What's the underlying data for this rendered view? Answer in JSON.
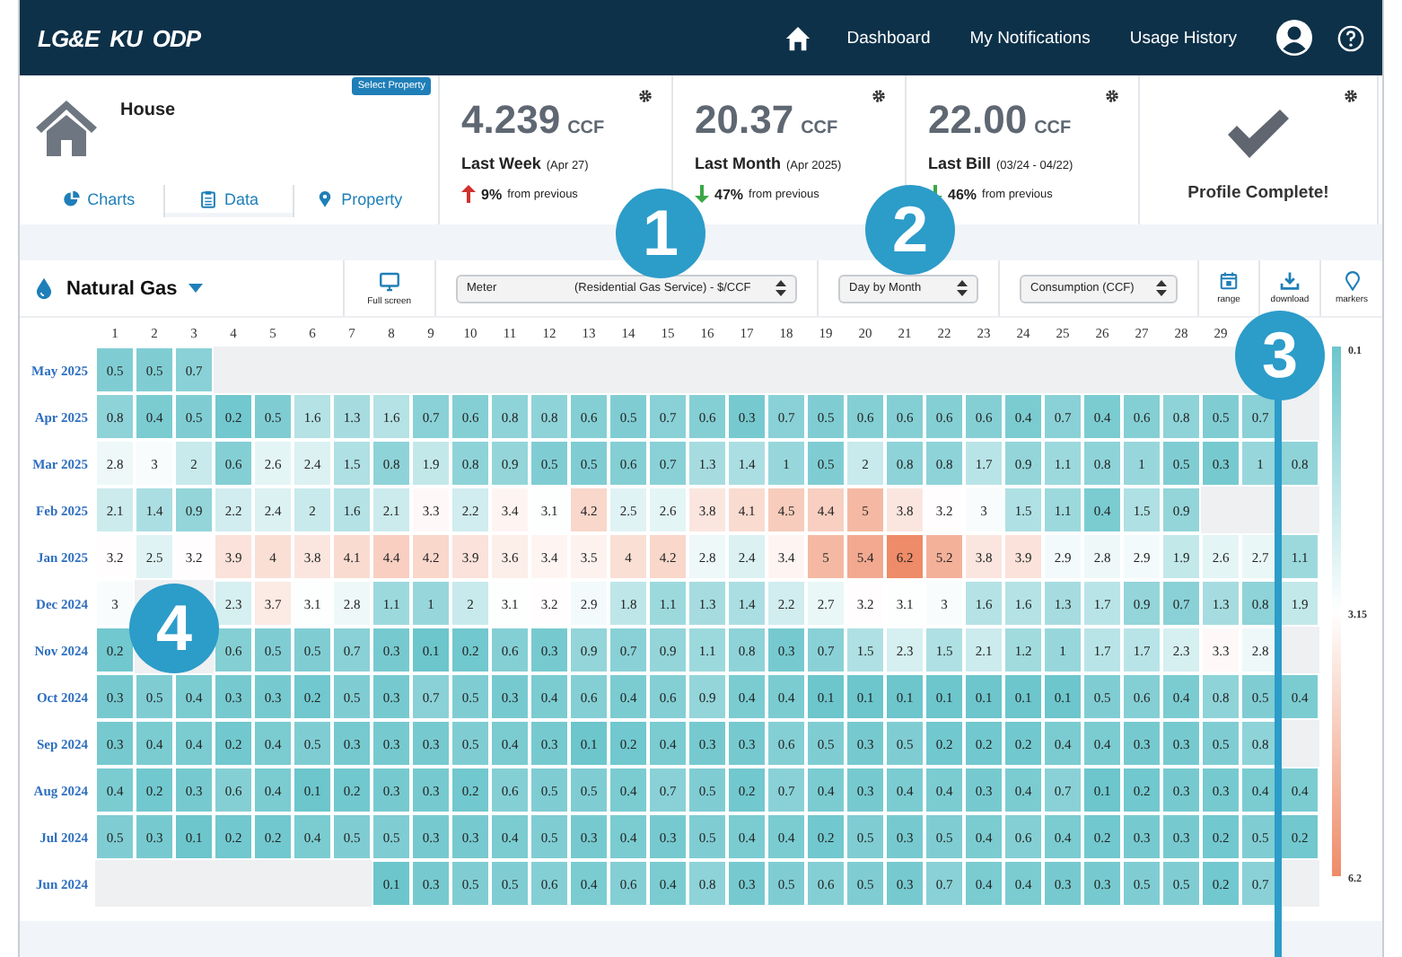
{
  "nav": {
    "logos": [
      "LG&E",
      "KU",
      "ODP"
    ],
    "links": [
      {
        "label": "Dashboard"
      },
      {
        "label": "My Notifications"
      },
      {
        "label": "Usage History"
      }
    ]
  },
  "property": {
    "name": "House",
    "select_label": "Select Property",
    "tabs": [
      {
        "label": "Charts",
        "selected": false
      },
      {
        "label": "Data",
        "selected": true
      },
      {
        "label": "Property",
        "selected": false
      }
    ]
  },
  "stats": [
    {
      "value": "4.239",
      "unit": "CCF",
      "label": "Last Week",
      "period": "(Apr 27)",
      "kind": "up",
      "change": "9%",
      "change_text": "from previous"
    },
    {
      "value": "20.37",
      "unit": "CCF",
      "label": "Last Month",
      "period": "(Apr 2025)",
      "kind": "down",
      "change": "47%",
      "change_text": "from previous"
    },
    {
      "value": "22.00",
      "unit": "CCF",
      "label": "Last Bill",
      "period": "(03/24 - 04/22)",
      "kind": "down",
      "change": "46%",
      "change_text": "from previous"
    }
  ],
  "profile": {
    "label": "Profile Complete!"
  },
  "toolbar": {
    "utility": "Natural Gas",
    "fullscreen": "Full screen",
    "selects": [
      {
        "parts": [
          "Meter",
          "(Residential Gas Service) - $/CCF"
        ]
      },
      {
        "parts": [
          "Day by Month"
        ]
      },
      {
        "parts": [
          "Consumption (CCF)"
        ]
      }
    ],
    "tools": [
      {
        "kind": "range",
        "label": "range"
      },
      {
        "kind": "download",
        "label": "download"
      },
      {
        "kind": "markers",
        "label": "markers"
      }
    ]
  },
  "heatmap": {
    "days": [
      "1",
      "2",
      "3",
      "4",
      "5",
      "6",
      "7",
      "8",
      "9",
      "10",
      "11",
      "12",
      "13",
      "14",
      "15",
      "16",
      "17",
      "18",
      "19",
      "20",
      "21",
      "22",
      "23",
      "24",
      "25",
      "26",
      "27",
      "28",
      "29"
    ],
    "rows": [
      {
        "month": "May 2025",
        "cells": [
          "0.5",
          "0.5",
          "0.7"
        ]
      },
      {
        "month": "Apr 2025",
        "cells": [
          "0.8",
          "0.4",
          "0.5",
          "0.2",
          "0.5",
          "1.6",
          "1.3",
          "1.6",
          "0.7",
          "0.6",
          "0.8",
          "0.8",
          "0.6",
          "0.5",
          "0.7",
          "0.6",
          "0.3",
          "0.7",
          "0.5",
          "0.6",
          "0.6",
          "0.6",
          "0.6",
          "0.4",
          "0.7",
          "0.4",
          "0.6",
          "0.8",
          "0.5",
          "0.7"
        ]
      },
      {
        "month": "Mar 2025",
        "cells": [
          "2.8",
          "3",
          "2",
          "0.6",
          "2.6",
          "2.4",
          "1.5",
          "0.8",
          "1.9",
          "0.8",
          "0.9",
          "0.5",
          "0.5",
          "0.6",
          "0.7",
          "1.3",
          "1.4",
          "1",
          "0.5",
          "2",
          "0.8",
          "0.8",
          "1.7",
          "0.9",
          "1.1",
          "0.8",
          "1",
          "0.5",
          "0.3",
          "1",
          "0.8"
        ]
      },
      {
        "month": "Feb 2025",
        "cells": [
          "2.1",
          "1.4",
          "0.9",
          "2.2",
          "2.4",
          "2",
          "1.6",
          "2.1",
          "3.3",
          "2.2",
          "3.4",
          "3.1",
          "4.2",
          "2.5",
          "2.6",
          "3.8",
          "4.1",
          "4.5",
          "4.4",
          "5",
          "3.8",
          "3.2",
          "3",
          "1.5",
          "1.1",
          "0.4",
          "1.5",
          "0.9"
        ]
      },
      {
        "month": "Jan 2025",
        "cells": [
          "3.2",
          "2.5",
          "3.2",
          "3.9",
          "4",
          "3.8",
          "4.1",
          "4.4",
          "4.2",
          "3.9",
          "3.6",
          "3.4",
          "3.5",
          "4",
          "4.2",
          "2.8",
          "2.4",
          "3.4",
          "5",
          "5.4",
          "6.2",
          "5.2",
          "3.8",
          "3.9",
          "2.9",
          "2.8",
          "2.9",
          "1.9",
          "2.6",
          "2.7",
          "1.1"
        ]
      },
      {
        "month": "Dec 2024",
        "cells": [
          "3",
          null,
          null,
          "2.3",
          "3.7",
          "3.1",
          "2.8",
          "1.1",
          "1",
          "2",
          "3.1",
          "3.2",
          "2.9",
          "1.8",
          "1.1",
          "1.3",
          "1.4",
          "2.2",
          "2.7",
          "3.2",
          "3.1",
          "3",
          "1.6",
          "1.6",
          "1.3",
          "1.7",
          "0.9",
          "0.7",
          "1.3",
          "0.8",
          "1.9"
        ]
      },
      {
        "month": "Nov 2024",
        "cells": [
          "0.2",
          null,
          null,
          "0.6",
          "0.5",
          "0.5",
          "0.7",
          "0.3",
          "0.1",
          "0.2",
          "0.6",
          "0.3",
          "0.9",
          "0.7",
          "0.9",
          "1.1",
          "0.8",
          "0.3",
          "0.7",
          "1.5",
          "2.3",
          "1.5",
          "2.1",
          "1.2",
          "1",
          "1.7",
          "1.7",
          "2.3",
          "3.3",
          "2.8"
        ]
      },
      {
        "month": "Oct 2024",
        "cells": [
          "0.3",
          "0.5",
          "0.4",
          "0.3",
          "0.3",
          "0.2",
          "0.5",
          "0.3",
          "0.7",
          "0.5",
          "0.3",
          "0.4",
          "0.6",
          "0.4",
          "0.6",
          "0.9",
          "0.4",
          "0.4",
          "0.1",
          "0.1",
          "0.1",
          "0.1",
          "0.1",
          "0.1",
          "0.1",
          "0.5",
          "0.6",
          "0.4",
          "0.8",
          "0.5",
          "0.4"
        ]
      },
      {
        "month": "Sep 2024",
        "cells": [
          "0.3",
          "0.4",
          "0.4",
          "0.2",
          "0.4",
          "0.5",
          "0.3",
          "0.3",
          "0.3",
          "0.5",
          "0.4",
          "0.3",
          "0.1",
          "0.2",
          "0.4",
          "0.3",
          "0.3",
          "0.6",
          "0.5",
          "0.3",
          "0.5",
          "0.2",
          "0.2",
          "0.2",
          "0.4",
          "0.4",
          "0.3",
          "0.3",
          "0.5",
          "0.8"
        ]
      },
      {
        "month": "Aug 2024",
        "cells": [
          "0.4",
          "0.2",
          "0.3",
          "0.6",
          "0.4",
          "0.1",
          "0.2",
          "0.3",
          "0.3",
          "0.2",
          "0.6",
          "0.5",
          "0.5",
          "0.4",
          "0.7",
          "0.5",
          "0.2",
          "0.7",
          "0.4",
          "0.3",
          "0.4",
          "0.4",
          "0.3",
          "0.4",
          "0.7",
          "0.1",
          "0.2",
          "0.3",
          "0.3",
          "0.4",
          "0.4"
        ]
      },
      {
        "month": "Jul 2024",
        "cells": [
          "0.5",
          "0.3",
          "0.1",
          "0.2",
          "0.2",
          "0.4",
          "0.5",
          "0.5",
          "0.3",
          "0.3",
          "0.4",
          "0.5",
          "0.3",
          "0.4",
          "0.3",
          "0.5",
          "0.4",
          "0.4",
          "0.2",
          "0.5",
          "0.3",
          "0.5",
          "0.4",
          "0.6",
          "0.4",
          "0.2",
          "0.3",
          "0.3",
          "0.2",
          "0.5",
          "0.2"
        ]
      },
      {
        "month": "Jun 2024",
        "cells": [
          null,
          null,
          null,
          null,
          null,
          null,
          null,
          "0.1",
          "0.3",
          "0.5",
          "0.5",
          "0.6",
          "0.4",
          "0.6",
          "0.4",
          "0.8",
          "0.3",
          "0.5",
          "0.6",
          "0.5",
          "0.3",
          "0.7",
          "0.4",
          "0.4",
          "0.3",
          "0.3",
          "0.5",
          "0.5",
          "0.2",
          "0.7"
        ]
      }
    ],
    "legend": {
      "min": "0.1",
      "mid": "3.15",
      "max": "6.2"
    }
  },
  "callouts": [
    "1",
    "2",
    "3",
    "4"
  ]
}
